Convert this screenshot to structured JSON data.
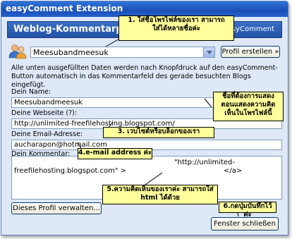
{
  "window": {
    "title": "easyComment Extension"
  },
  "banner": {
    "title": "Weblog-Kommentarpro",
    "brand": "easyComment"
  },
  "profile": {
    "selected": "Meesubandmeesuk",
    "create_button": "Profil erstellen »"
  },
  "info_text": "Alle unten ausgefüllten Daten werden nach Knopfdruck auf den easyComment-Button automatisch in das Kommentarfeld des gerade besuchten Blogs eingefügt.",
  "fields": {
    "name_label": "Dein Name:",
    "name_value": "Meesubandmeesuk",
    "website_label": "Deine Webseite (?):",
    "website_value": "http://unlimited-freefilehosting.blogspot.com/",
    "email_label": "Deine Email-Adresse:",
    "email_value": "aucharapon@hotmail.com",
    "comment_label": "Dein Kommentar:",
    "comment_line1": "\"http://unlimited-",
    "comment_line2": "freefilehosting.blogspot.com\" >",
    "comment_line2b": "</a>"
  },
  "buttons": {
    "manage": "Dieses Profil verwalten...",
    "close": "Fenster schließen"
  },
  "notes": {
    "n1_line1": "1. ใส่ชื่อโพรไฟล์ของเรา สามารถ",
    "n1_line2": "ใส่ได้หลายชื่อค่ะ",
    "n2_line1": "ชื่อที่ต้องการแสดง",
    "n2_line2": "ตอนแสดงความคิด",
    "n2_line3": "เห็นในโพรไฟล์นี้",
    "n3": "3. เวบไซต์หรือบล็อกของเรา",
    "n4": "4.e-mail address ค่ะ",
    "n5_line1": "5.ความคิดเห็นของเราค่ะ สามารถใส่",
    "n5_line2": "html ได้ด้วย",
    "n6": "6.กดปุ่มบันทึกไว้ค่ะ"
  },
  "colors": {
    "titlebar": "#1b4fb8",
    "note_fill": "#ffff9c"
  }
}
